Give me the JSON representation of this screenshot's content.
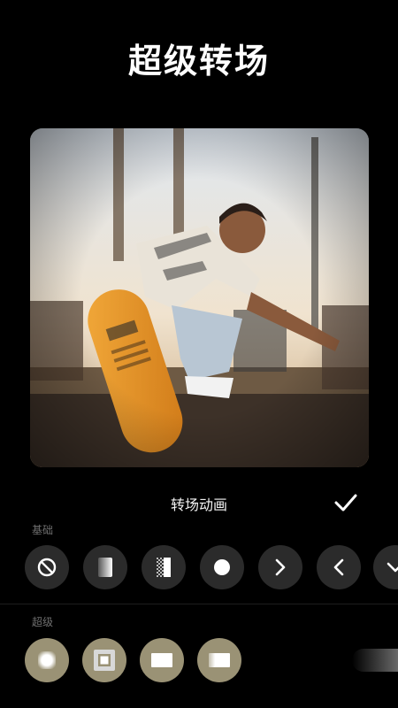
{
  "header": {
    "title": "超级转场"
  },
  "panel": {
    "title": "转场动画",
    "confirm_icon": "check-icon"
  },
  "basic": {
    "label": "基础",
    "items": [
      {
        "icon": "none-icon"
      },
      {
        "icon": "fade-gradient-icon"
      },
      {
        "icon": "dissolve-checker-icon"
      },
      {
        "icon": "circle-icon"
      },
      {
        "icon": "chevron-right-icon"
      },
      {
        "icon": "chevron-left-icon"
      },
      {
        "icon": "chevron-down-icon"
      }
    ]
  },
  "super": {
    "label": "超级",
    "items": [
      {
        "icon": "super-transition-1-icon"
      },
      {
        "icon": "super-transition-2-icon"
      },
      {
        "icon": "super-transition-3-icon"
      },
      {
        "icon": "super-transition-4-icon"
      }
    ]
  },
  "colors": {
    "background": "#000000",
    "button": "#2b2b2b",
    "super_button": "#9a9275",
    "label": "#6f6f6f"
  }
}
